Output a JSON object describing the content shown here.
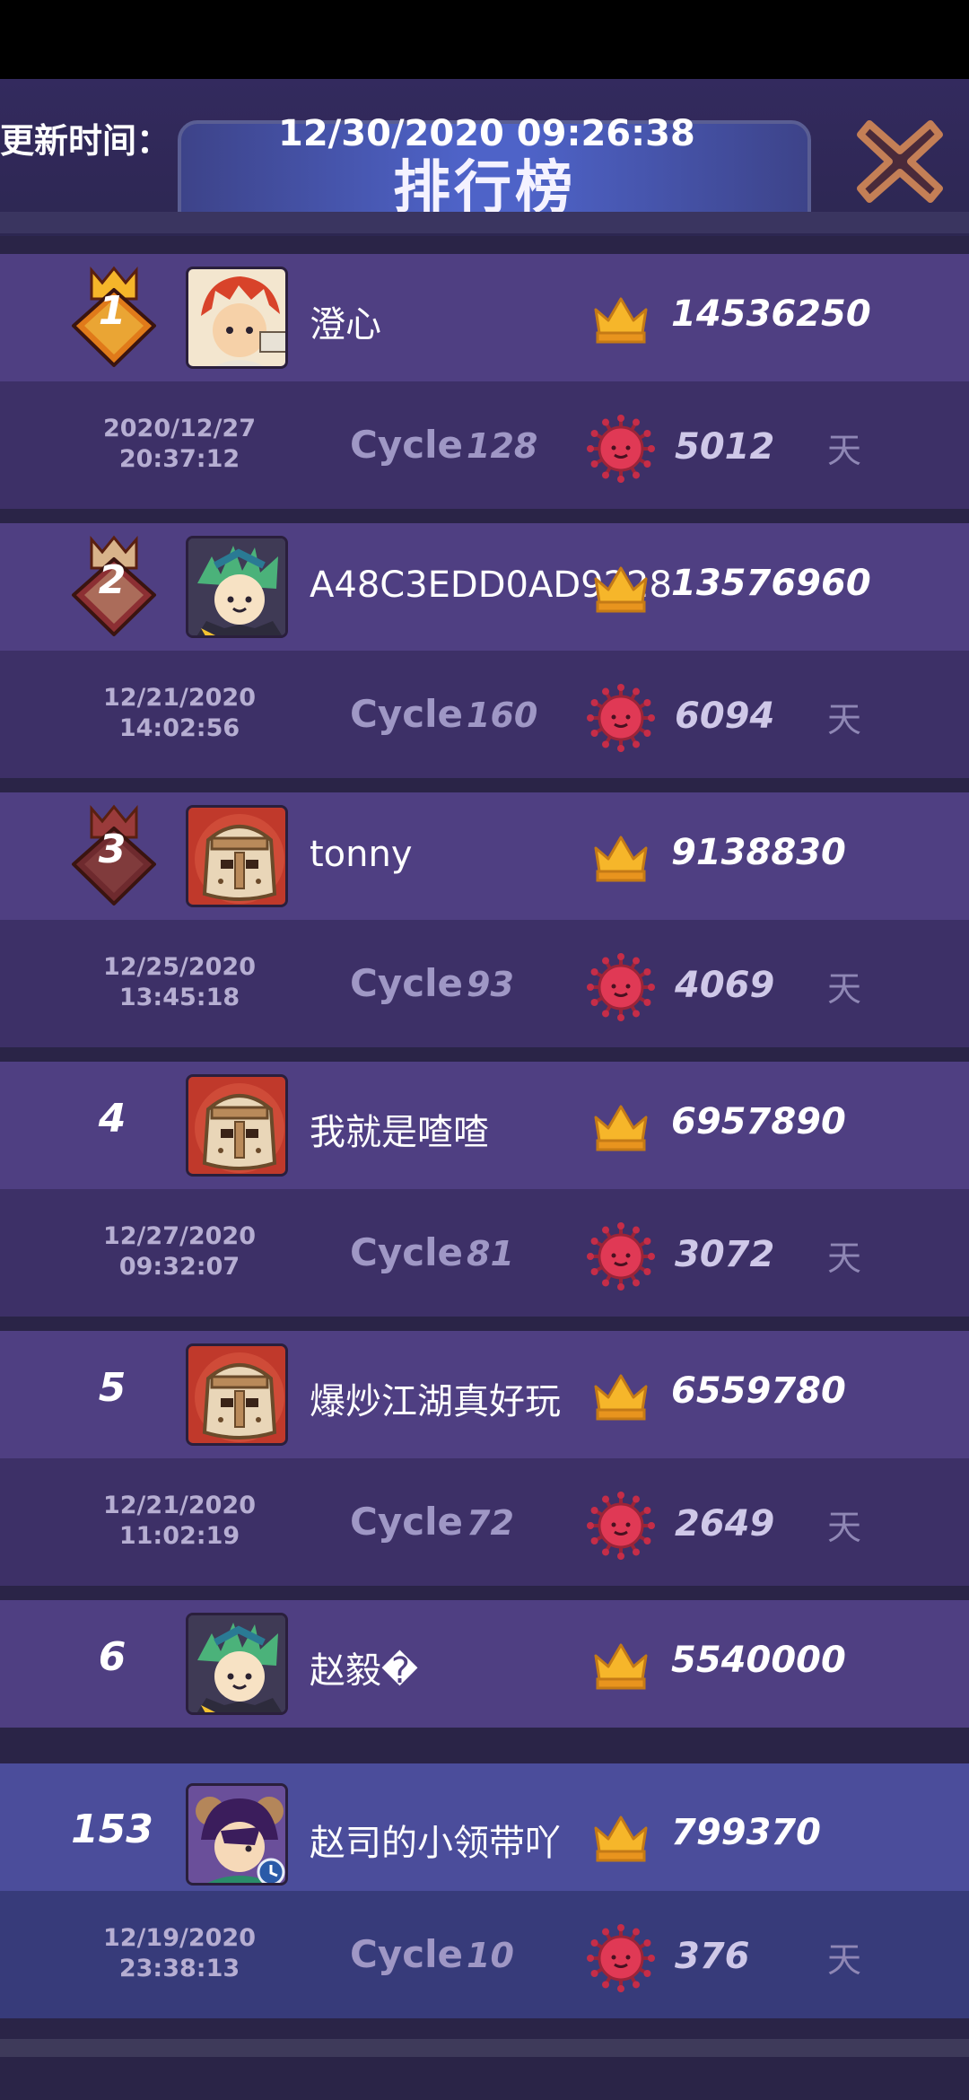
{
  "header": {
    "title": "排行榜",
    "update_label": "更新时间：",
    "update_time": "12/30/2020 09:26:38"
  },
  "rows": [
    {
      "rank": "1",
      "name": "澄心",
      "score": "14536250",
      "date": "2020/12/27",
      "time": "20:37:12",
      "cycle_label": "Cycle",
      "cycle": "128",
      "days": "5012",
      "days_unit": "天",
      "avatar": "red-hair-hero"
    },
    {
      "rank": "2",
      "name": "A48C3EDD0AD9228",
      "score": "13576960",
      "date": "12/21/2020",
      "time": "14:02:56",
      "cycle_label": "Cycle",
      "cycle": "160",
      "days": "6094",
      "days_unit": "天",
      "avatar": "green-hair-hero"
    },
    {
      "rank": "3",
      "name": "tonny",
      "score": "9138830",
      "date": "12/25/2020",
      "time": "13:45:18",
      "cycle_label": "Cycle",
      "cycle": "93",
      "days": "4069",
      "days_unit": "天",
      "avatar": "knight-helmet"
    },
    {
      "rank": "4",
      "name": "我就是喳喳",
      "score": "6957890",
      "date": "12/27/2020",
      "time": "09:32:07",
      "cycle_label": "Cycle",
      "cycle": "81",
      "days": "3072",
      "days_unit": "天",
      "avatar": "knight-helmet"
    },
    {
      "rank": "5",
      "name": "爆炒江湖真好玩",
      "score": "6559780",
      "date": "12/21/2020",
      "time": "11:02:19",
      "cycle_label": "Cycle",
      "cycle": "72",
      "days": "2649",
      "days_unit": "天",
      "avatar": "knight-helmet"
    },
    {
      "rank": "6",
      "name": "赵毅�",
      "score": "5540000",
      "avatar": "green-hair-hero"
    }
  ],
  "self_row": {
    "rank": "153",
    "name": "赵司的小领带吖",
    "score": "799370",
    "date": "12/19/2020",
    "time": "23:38:13",
    "cycle_label": "Cycle",
    "cycle": "10",
    "days": "376",
    "days_unit": "天",
    "avatar": "purple-hair-hero"
  },
  "colors": {
    "gold": "#f6b62a",
    "virus": "#e03955",
    "badge_gold": "#f08c1e",
    "badge_silver": "#8f3a3a",
    "badge_bronze": "#7a3535"
  }
}
